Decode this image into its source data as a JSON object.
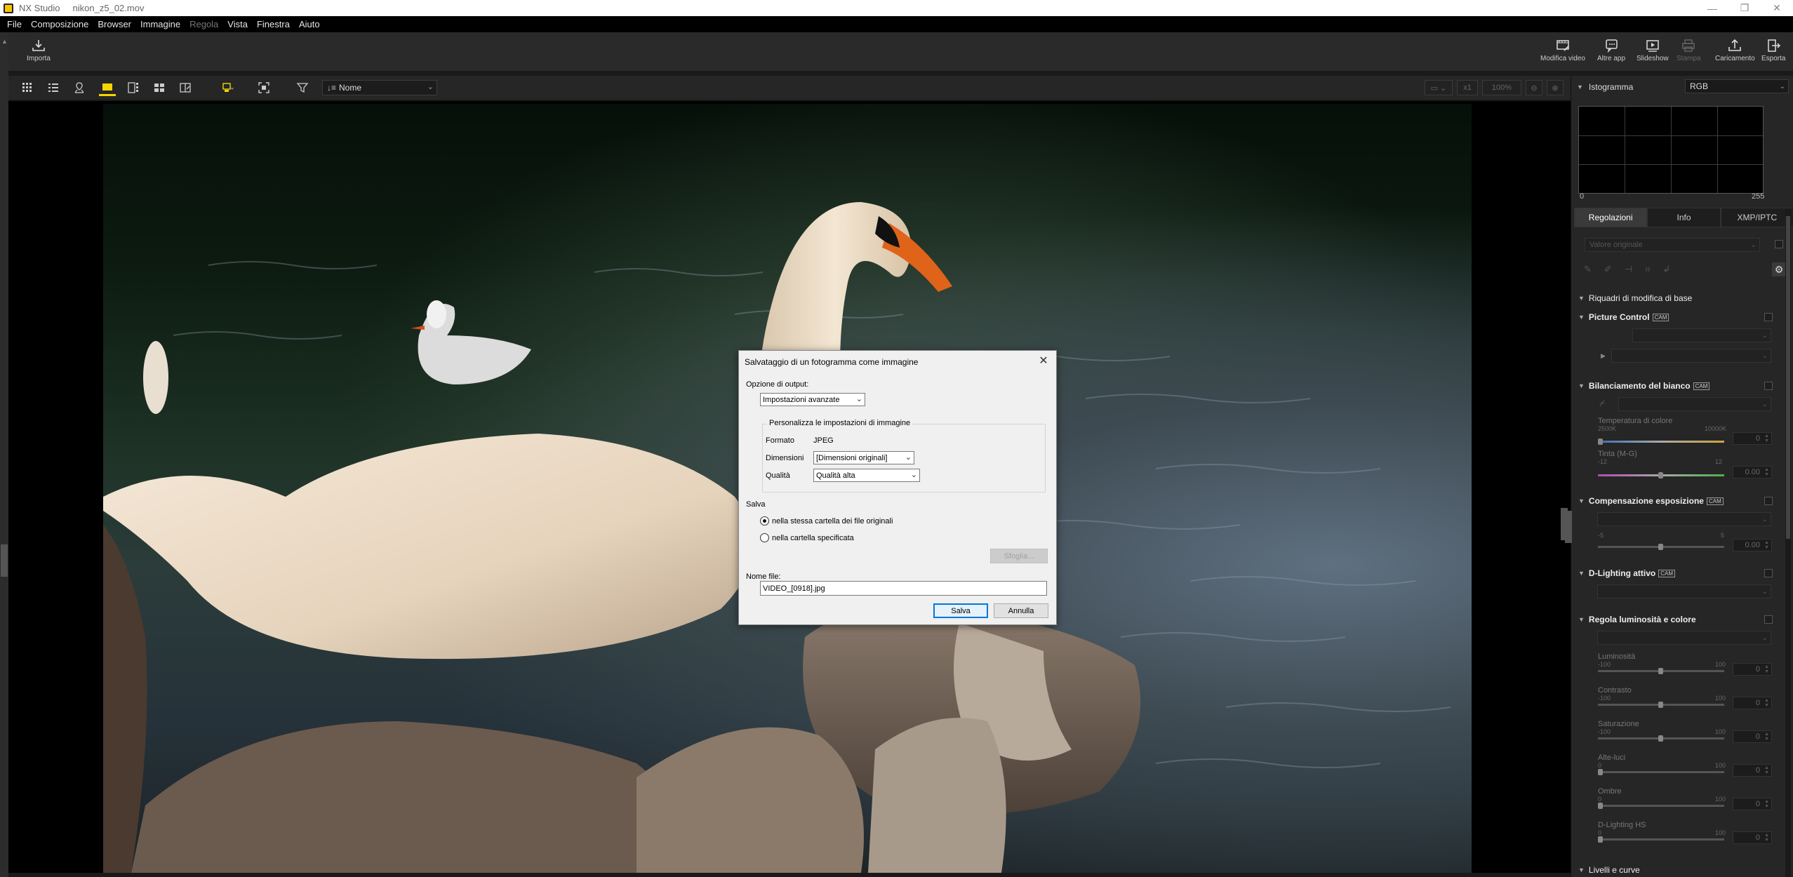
{
  "window": {
    "app_name": "NX Studio",
    "file_name": "nikon_z5_02.mov",
    "minimize": "—",
    "maximize": "❐",
    "close": "✕"
  },
  "menu": {
    "items": [
      "File",
      "Composizione",
      "Browser",
      "Immagine",
      "Regola",
      "Vista",
      "Finestra",
      "Aiuto"
    ],
    "disabled": [
      "Regola"
    ]
  },
  "toolbar": {
    "import_label": "Importa",
    "right": [
      {
        "label": "Modifica video",
        "icon": "edit-video-icon"
      },
      {
        "label": "Altre app",
        "icon": "other-apps-icon"
      },
      {
        "label": "Slideshow",
        "icon": "slideshow-icon"
      },
      {
        "label": "Stampa",
        "icon": "print-icon",
        "disabled": true
      },
      {
        "label": "Caricamento",
        "icon": "upload-icon"
      },
      {
        "label": "Esporta",
        "icon": "export-icon"
      }
    ]
  },
  "viewbar": {
    "sort_label": "Nome",
    "zoom_ratio": "x1",
    "zoom_percent": "100%",
    "active_view": "viewer-icon"
  },
  "panel": {
    "histogram_title": "Istogramma",
    "histogram_channel": "RGB",
    "histogram_min": "0",
    "histogram_max": "255",
    "tabs": [
      "Regolazioni",
      "Info",
      "XMP/IPTC"
    ],
    "active_tab": "Regolazioni",
    "preset_placeholder": "Valore originale",
    "section_basic": "Riquadri di modifica di base",
    "picture_control": "Picture Control",
    "white_balance": "Bilanciamento del bianco",
    "wb_temp_label": "Temperatura di colore",
    "wb_temp_min": "2500K",
    "wb_temp_max": "10000K",
    "wb_temp_value": "0",
    "wb_tint_label": "Tinta (M-G)",
    "wb_tint_min": "-12",
    "wb_tint_max": "12",
    "wb_tint_value": "0.00",
    "exposure": "Compensazione esposizione",
    "exp_min": "-5",
    "exp_max": "5",
    "exp_value": "0.00",
    "adl": "D-Lighting attivo",
    "brightness_color": "Regola luminosità e colore",
    "cam_badge": "CAM",
    "sliders": [
      {
        "label": "Luminosità",
        "min": "-100",
        "max": "100",
        "value": "0"
      },
      {
        "label": "Contrasto",
        "min": "-100",
        "max": "100",
        "value": "0"
      },
      {
        "label": "Saturazione",
        "min": "-100",
        "max": "100",
        "value": "0"
      },
      {
        "label": "Alte-luci",
        "min": "0",
        "max": "100",
        "value": "0"
      },
      {
        "label": "Ombre",
        "min": "0",
        "max": "100",
        "value": "0"
      },
      {
        "label": "D-Lighting HS",
        "min": "0",
        "max": "100",
        "value": "0"
      }
    ],
    "levels_curves": "Livelli e curve"
  },
  "dialog": {
    "title": "Salvataggio di un fotogramma come immagine",
    "output_label": "Opzione di output:",
    "output_value": "Impostazioni avanzate",
    "group_title": "Personalizza le impostazioni di immagine",
    "format_label": "Formato",
    "format_value": "JPEG",
    "size_label": "Dimensioni",
    "size_value": "[Dimensioni originali]",
    "quality_label": "Qualità",
    "quality_value": "Qualità alta",
    "save_label": "Salva",
    "radio_same": "nella stessa cartella dei file originali",
    "radio_specified": "nella cartella specificata",
    "browse_label": "Sfoglia...",
    "filename_label": "Nome file:",
    "filename_value": "VIDEO_[0918].jpg",
    "ok_label": "Salva",
    "cancel_label": "Annulla",
    "selected_option": "same"
  }
}
